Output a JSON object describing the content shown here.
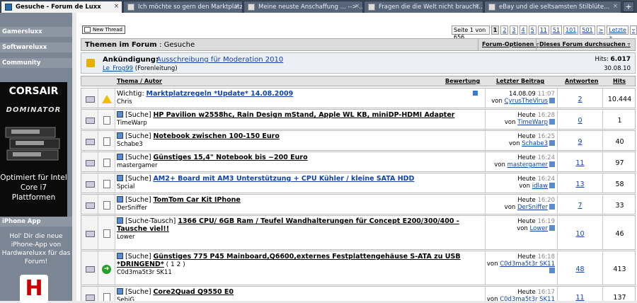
{
  "tabs": [
    {
      "title": "Gesuche - Forum de Luxx",
      "active": true
    },
    {
      "title": "Ich möchte so gern den Marktplatz...",
      "active": false
    },
    {
      "title": "Meine neuste Anschaffung ... --> ...",
      "active": false
    },
    {
      "title": "Fragen die die Welt nicht braucht......",
      "active": false
    },
    {
      "title": "eBay und die seltsamsten Stilblüte...",
      "active": false
    }
  ],
  "tab_close": "×",
  "new_tab": "+",
  "sidebar": {
    "categories": [
      {
        "label": "Gamersluxx"
      },
      {
        "label": "Softwareluxx"
      },
      {
        "label": "Community"
      }
    ],
    "ad": {
      "logo": "CORSAIR",
      "product": "DOMINATOR",
      "tagline": "Optimiert für Intel Core i7 Plattformen"
    },
    "iphone_label": "iPhone App",
    "iphone_text": "Hol' Dir die neue iPhone-App von Hardwareluxx für das Forum!",
    "hx_letter": "H"
  },
  "toolbar": {
    "new_thread": "New Thread"
  },
  "pager": {
    "info": "Seite 1 von 656",
    "pages": [
      "1",
      "2",
      "3",
      "4",
      "5",
      "11",
      "51",
      "101",
      "501",
      ">",
      "Letzte »",
      "▿"
    ],
    "current": "1"
  },
  "forum": {
    "title": "Themen im Forum",
    "name": ": Gesuche",
    "options": "Forum-Optionen ▿",
    "search": "Dieses Forum durchsuchen ▿"
  },
  "announcement": {
    "label": "Ankündigung:",
    "title": "Ausschreibung für Moderation 2010",
    "user": "Le_Frog99",
    "role": "(Forenleitung)",
    "hits_label": "Hits:",
    "hits": "6.017",
    "date": "30.08.10"
  },
  "columns": {
    "topic": "Thema",
    "author": "Autor",
    "rating": "Bewertung",
    "last": "Letzter Beitrag",
    "answers": "Antworten",
    "hits": "Hits"
  },
  "threads": [
    {
      "prefix": "Wichtig:",
      "title": "Marktplatzregeln *Update* 14.08.2009",
      "author": "Chris",
      "date": "14.08.09",
      "time": "11:07",
      "by": "CyrusTheVirus",
      "answers": "2",
      "hits": "10.444",
      "icon": "warn",
      "blue": true
    },
    {
      "prefix": "[Suche]",
      "title": "HP Pavilion w2558hc, Rain Design mStand, Apple WL KB, miniDP-HDMI Adapter",
      "author": "TimeWarp",
      "date": "Heute",
      "time": "16:28",
      "by": "TimeWarp",
      "answers": "0",
      "hits": "1",
      "icon": "doc"
    },
    {
      "prefix": "[Suche]",
      "title": "Notebook zwischen 100-150 Euro",
      "author": "Schabe3",
      "date": "Heute",
      "time": "16:25",
      "by": "Schabe3",
      "answers": "9",
      "hits": "40",
      "icon": "doc"
    },
    {
      "prefix": "[Suche]",
      "title": "Günstiges 15,4\" Notebook bis ~200 Euro",
      "author": "mastergamer",
      "date": "Heute",
      "time": "16:24",
      "by": "mastergamer",
      "answers": "11",
      "hits": "97",
      "icon": "doc"
    },
    {
      "prefix": "[Suche]",
      "title": "AM2+ Board mit AM3 Unterstützung + CPU Kühler / kleine SATA HDD",
      "author": "Spcial",
      "date": "Heute",
      "time": "16:24",
      "by": "idlaw",
      "answers": "13",
      "hits": "58",
      "icon": "doc",
      "blue": true
    },
    {
      "prefix": "[Suche]",
      "title": "TomTom Car Kit IPhone",
      "author": "DerSniffer",
      "date": "Heute",
      "time": "16:20",
      "by": "DerSniffer",
      "answers": "7",
      "hits": "33",
      "icon": "doc"
    },
    {
      "prefix": "[Suche-Tausch]",
      "title": "1366 CPU/ 6GB Ram / Teufel Wandhalterungen für Concept E200/300/400 - Tausche viel!!",
      "author": "Lower",
      "date": "Heute",
      "time": "16:19",
      "by": "Lower",
      "answers": "10",
      "hits": "46",
      "icon": "doc"
    },
    {
      "prefix": "[Suche]",
      "title": "Günstiges 775 P45 Mainboard,Q6600,externes Festplattengehäuse S-ATA zu USB *DRINGEND*",
      "pages": "( 1 2 )",
      "author": "C0d3ma5t3r SK11",
      "date": "Heute",
      "time": "16:18",
      "by": "C0d3ma5t3r SK11",
      "answers": "48",
      "hits": "413",
      "icon": "arrow"
    },
    {
      "prefix": "[Suche]",
      "title": "Core2Quad Q9550 E0",
      "author": "SebiG",
      "date": "Heute",
      "time": "16:17",
      "by": "C0d3ma5t3r SK11",
      "answers": "11",
      "hits": "137",
      "icon": "doc"
    }
  ],
  "colors": {
    "sidebar": "#7b8695",
    "link": "#1144aa",
    "header": "#dcdcdc"
  }
}
